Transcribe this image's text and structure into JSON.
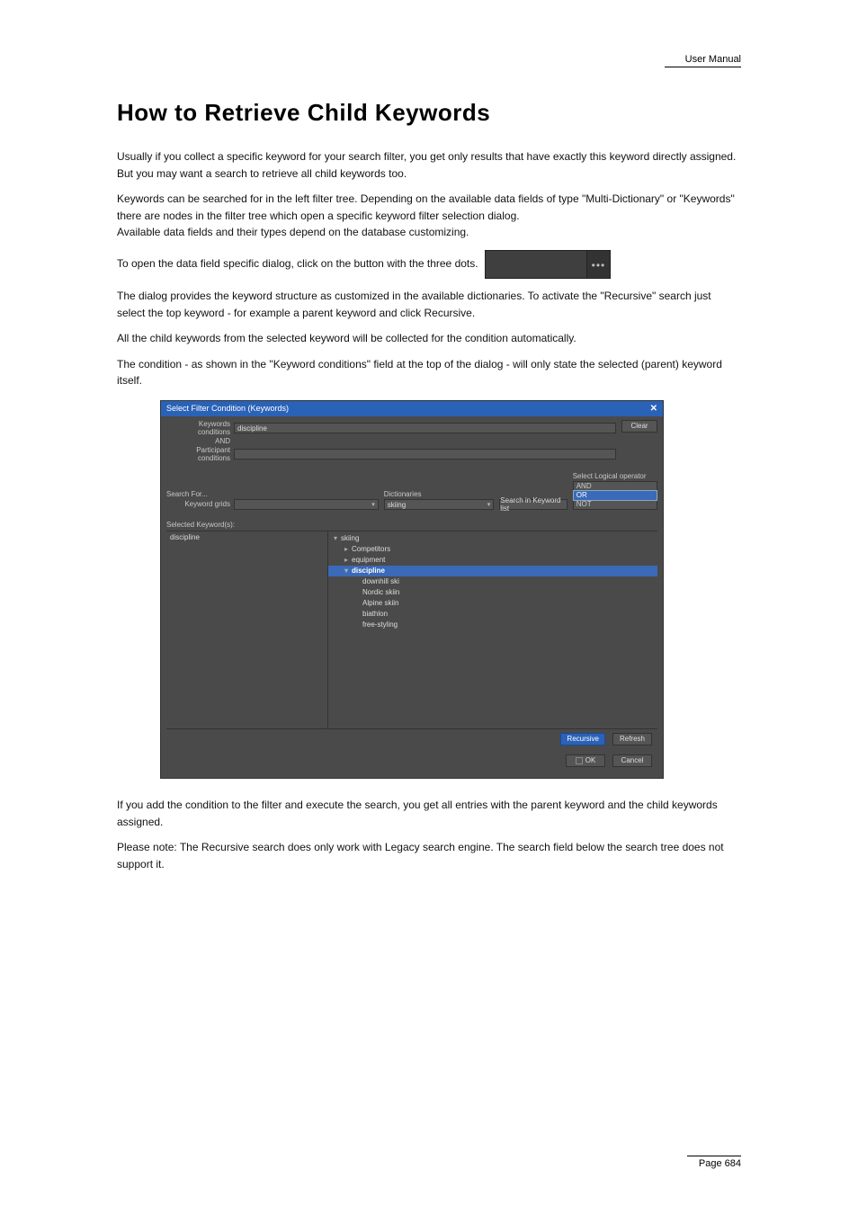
{
  "header": {
    "right": "User Manual"
  },
  "page_title": "How to Retrieve Child Keywords",
  "para1_a": "Usually if you collect a specific keyword for your search filter, you get only results that have exactly this keyword directly assigned.",
  "para1_b": "But you may want a search to retrieve all child keywords too.",
  "para2_a": "Keywords can be searched for in the left filter tree. Depending on the available data fields of type \"Multi-Dictionary\" or \"Keywords\" there are nodes in the filter tree which open a specific keyword filter selection dialog.",
  "para2_b": "Available data fields and their types depend on the database customizing.",
  "para3": "To open the data field specific dialog, click on the button with the three dots.",
  "field_button_dots": "•••",
  "para4": "The dialog provides the keyword structure as customized in the available dictionaries. To activate the \"Recursive\" search just select the top keyword - for example a parent keyword and click Recursive.",
  "para5": "All the child keywords from the selected keyword will be collected for the condition automatically.",
  "para6": "The condition - as shown in the \"Keyword conditions\" field at the top of the dialog - will only state the selected (parent) keyword itself.",
  "dialog": {
    "title": "Select Filter Condition (Keywords)",
    "close": "✕",
    "cond_labels": {
      "keywords": "Keywords conditions",
      "and": "AND",
      "participant": "Participant conditions"
    },
    "cond_values": {
      "keywords": "discipline",
      "participant": ""
    },
    "clear": "Clear",
    "search_for_label": "Search For...",
    "keyword_grids_label": "Keyword grids",
    "dictionaries_label": "Dictionaries",
    "dictionary_value": "skiing",
    "search_btn": "Search in Keyword list",
    "logical_label": "Select Logical operator",
    "logical_items": [
      "AND",
      "OR",
      "NOT"
    ],
    "logical_selected_index": 1,
    "selected_kw_label": "Selected Keyword(s):",
    "left_tree": [
      "discipline"
    ],
    "right_tree": [
      {
        "level": 0,
        "arrow": "▾",
        "label": "skiing",
        "selected": false
      },
      {
        "level": 1,
        "arrow": "▸",
        "label": "Competitors",
        "selected": false
      },
      {
        "level": 1,
        "arrow": "▸",
        "label": "equipment",
        "selected": false
      },
      {
        "level": 1,
        "arrow": "▾",
        "label": "discipline",
        "selected": true
      },
      {
        "level": 2,
        "arrow": "",
        "label": "downhill ski",
        "selected": false
      },
      {
        "level": 2,
        "arrow": "",
        "label": "Nordic skiin",
        "selected": false
      },
      {
        "level": 2,
        "arrow": "",
        "label": "Alpine skiin",
        "selected": false
      },
      {
        "level": 2,
        "arrow": "",
        "label": "biathlon",
        "selected": false
      },
      {
        "level": 2,
        "arrow": "",
        "label": "free-styling",
        "selected": false
      }
    ],
    "buttons": {
      "recursive": "Recursive",
      "refresh": "Refresh",
      "ok": "OK",
      "cancel": "Cancel"
    }
  },
  "para7": "If you add the condition to the filter and execute the search, you get all entries with the parent keyword and the child keywords assigned.",
  "note": "Please note: The Recursive search does only work with Legacy search engine. The search field below the search tree does not support it.",
  "footer": "Page 684"
}
